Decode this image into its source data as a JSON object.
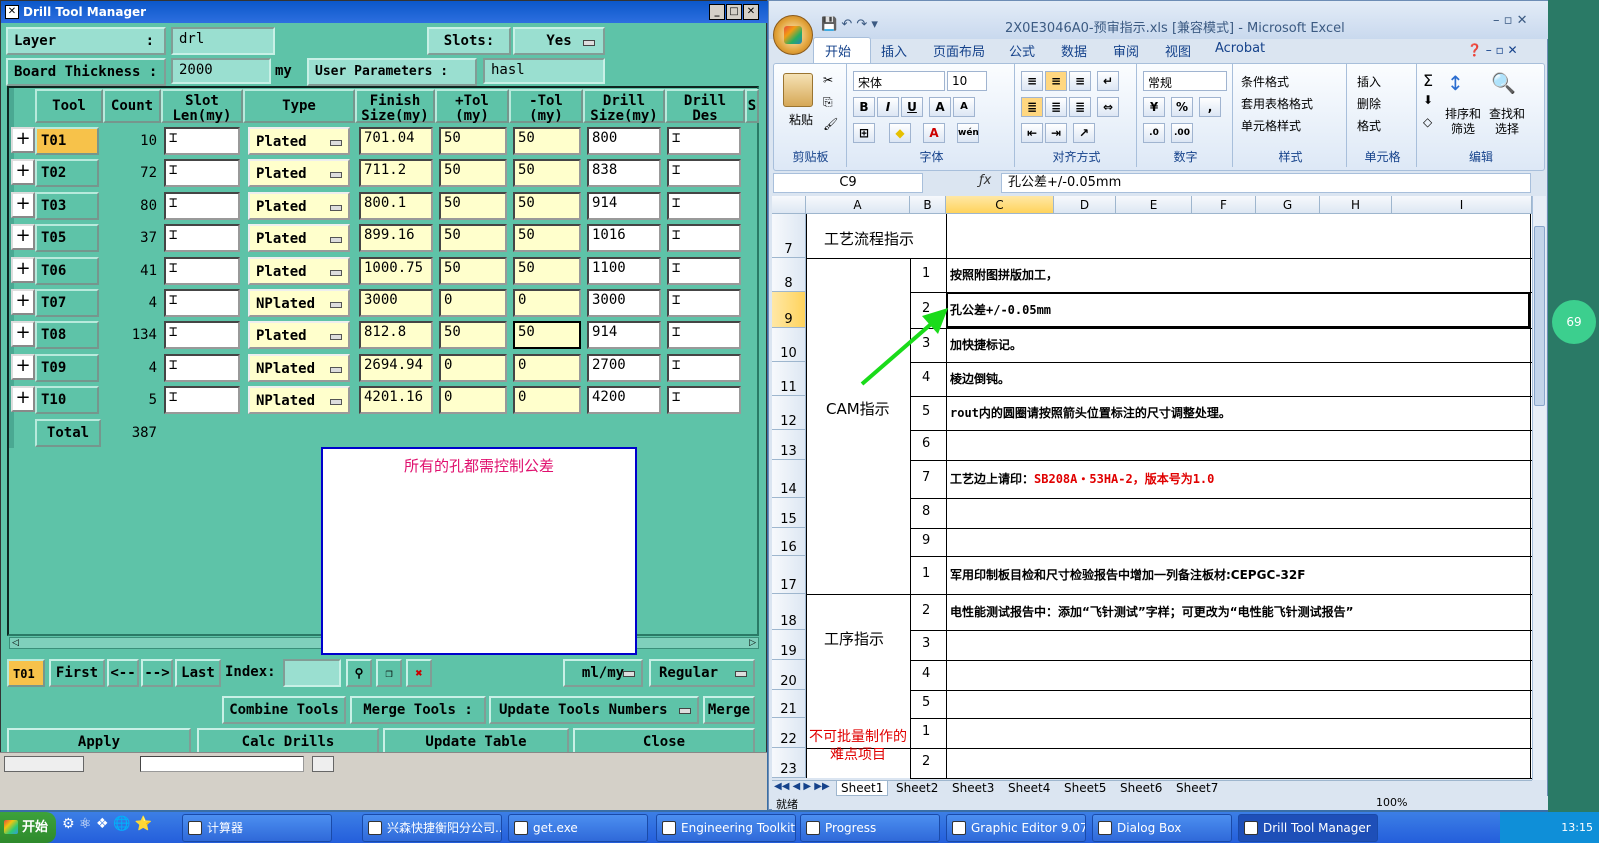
{
  "dtm": {
    "title": "Drill Tool Manager",
    "layer_label": "Layer",
    "layer_sep": ":",
    "layer_value": "drl",
    "slots_label": "Slots:",
    "slots_value": "Yes",
    "board_label": "Board Thickness :",
    "board_value": "2000",
    "board_unit": "my",
    "user_params_label": "User Parameters :",
    "user_params_value": "hasl",
    "headers": [
      "Tool",
      "Count",
      "Slot\nLen(my)",
      "Type",
      "Finish\nSize(my)",
      "+Tol\n(my)",
      "-Tol\n(my)",
      "Drill\nSize(my)",
      "Drill\nDes",
      "S"
    ],
    "rows": [
      {
        "tool": "T01",
        "count": "10",
        "type": "Plated",
        "finish": "701.04",
        "ptol": "50",
        "ntol": "50",
        "drill": "800"
      },
      {
        "tool": "T02",
        "count": "72",
        "type": "Plated",
        "finish": "711.2",
        "ptol": "50",
        "ntol": "50",
        "drill": "838"
      },
      {
        "tool": "T03",
        "count": "80",
        "type": "Plated",
        "finish": "800.1",
        "ptol": "50",
        "ntol": "50",
        "drill": "914"
      },
      {
        "tool": "T05",
        "count": "37",
        "type": "Plated",
        "finish": "899.16",
        "ptol": "50",
        "ntol": "50",
        "drill": "1016"
      },
      {
        "tool": "T06",
        "count": "41",
        "type": "Plated",
        "finish": "1000.75",
        "ptol": "50",
        "ntol": "50",
        "drill": "1100"
      },
      {
        "tool": "T07",
        "count": "4",
        "type": "NPlated",
        "finish": "3000",
        "ptol": "0",
        "ntol": "0",
        "drill": "3000"
      },
      {
        "tool": "T08",
        "count": "134",
        "type": "Plated",
        "finish": "812.8",
        "ptol": "50",
        "ntol": "50",
        "drill": "914"
      },
      {
        "tool": "T09",
        "count": "4",
        "type": "NPlated",
        "finish": "2694.94",
        "ptol": "0",
        "ntol": "0",
        "drill": "2700"
      },
      {
        "tool": "T10",
        "count": "5",
        "type": "NPlated",
        "finish": "4201.16",
        "ptol": "0",
        "ntol": "0",
        "drill": "4200"
      }
    ],
    "total_label": "Total",
    "total_value": "387",
    "note_text": "所有的孔都需控制公差",
    "nav": {
      "current": "T01",
      "first": "First",
      "prev": "<--",
      "next": "-->",
      "last": "Last",
      "index_label": "Index:",
      "unit_select": "ml/my",
      "mode_select": "Regular"
    },
    "actions": {
      "combine": "Combine Tools",
      "merge_label": "Merge Tools :",
      "update_numbers": "Update Tools Numbers",
      "merge": "Merge"
    },
    "bottom": {
      "apply": "Apply",
      "calc": "Calc Drills",
      "update_table": "Update Table",
      "close": "Close"
    }
  },
  "excel": {
    "title": "2X0E3046A0-预审指示.xls  [兼容模式] - Microsoft Excel",
    "tabs": [
      "开始",
      "插入",
      "页面布局",
      "公式",
      "数据",
      "审阅",
      "视图",
      "Acrobat"
    ],
    "groups": [
      "剪贴板",
      "字体",
      "对齐方式",
      "数字",
      "样式",
      "单元格",
      "编辑"
    ],
    "paste": "粘贴",
    "font_name": "宋体",
    "font_size": "10",
    "number_format": "常规",
    "styles": [
      "条件格式",
      "套用表格格式",
      "单元格样式"
    ],
    "cells_btns": [
      "插入",
      "删除",
      "格式"
    ],
    "edit_btns": [
      "排序和筛选",
      "查找和选择"
    ],
    "name_box": "C9",
    "formula": "孔公差+/-0.05mm",
    "columns": [
      "A",
      "B",
      "C",
      "D",
      "E",
      "F",
      "G",
      "H",
      "I"
    ],
    "rows": [
      "7",
      "8",
      "9",
      "10",
      "11",
      "12",
      "13",
      "14",
      "15",
      "16",
      "17",
      "18",
      "19",
      "20",
      "21",
      "22",
      "23"
    ],
    "process_title": "工艺流程指示",
    "cam_title": "CAM指示",
    "proc_title": "工序指示",
    "hard_title": "不可批量制作的难点项目",
    "cam_items": [
      {
        "n": "1",
        "t": "按照附图拼版加工，"
      },
      {
        "n": "2",
        "t": "孔公差+/-0.05mm"
      },
      {
        "n": "3",
        "t": "加快捷标记。"
      },
      {
        "n": "4",
        "t": "棱边倒钝。"
      },
      {
        "n": "5",
        "t": "rout内的圆圈请按照箭头位置标注的尺寸调整处理。"
      },
      {
        "n": "6",
        "t": ""
      },
      {
        "n": "7",
        "t": "工艺边上请印：",
        "red": "SB208A・53HA-2，版本号为1.0"
      },
      {
        "n": "8",
        "t": ""
      },
      {
        "n": "9",
        "t": ""
      }
    ],
    "proc_items": [
      {
        "n": "1",
        "t": "军用印制板目检和尺寸检验报告中增加一列备注板材:CEPGC-32F"
      },
      {
        "n": "2",
        "t": "电性能测试报告中：添加“飞针测试”字样；可更改为“电性能飞针测试报告”"
      },
      {
        "n": "3",
        "t": ""
      },
      {
        "n": "4",
        "t": ""
      },
      {
        "n": "5",
        "t": ""
      }
    ],
    "hard_items": [
      {
        "n": "1"
      },
      {
        "n": "2"
      }
    ],
    "sheets": [
      "Sheet1",
      "Sheet2",
      "Sheet3",
      "Sheet4",
      "Sheet5",
      "Sheet6",
      "Sheet7"
    ],
    "status": "就绪",
    "zoom": "100%"
  },
  "taskbar": {
    "start": "开始",
    "items": [
      "计算器",
      "兴森快捷衡阳分公司...",
      "get.exe",
      "Engineering Toolkit 9....",
      "Progress",
      "Graphic Editor 9.07b2 ...",
      "Dialog Box",
      "Drill Tool Manager"
    ],
    "clock": "13:15"
  }
}
